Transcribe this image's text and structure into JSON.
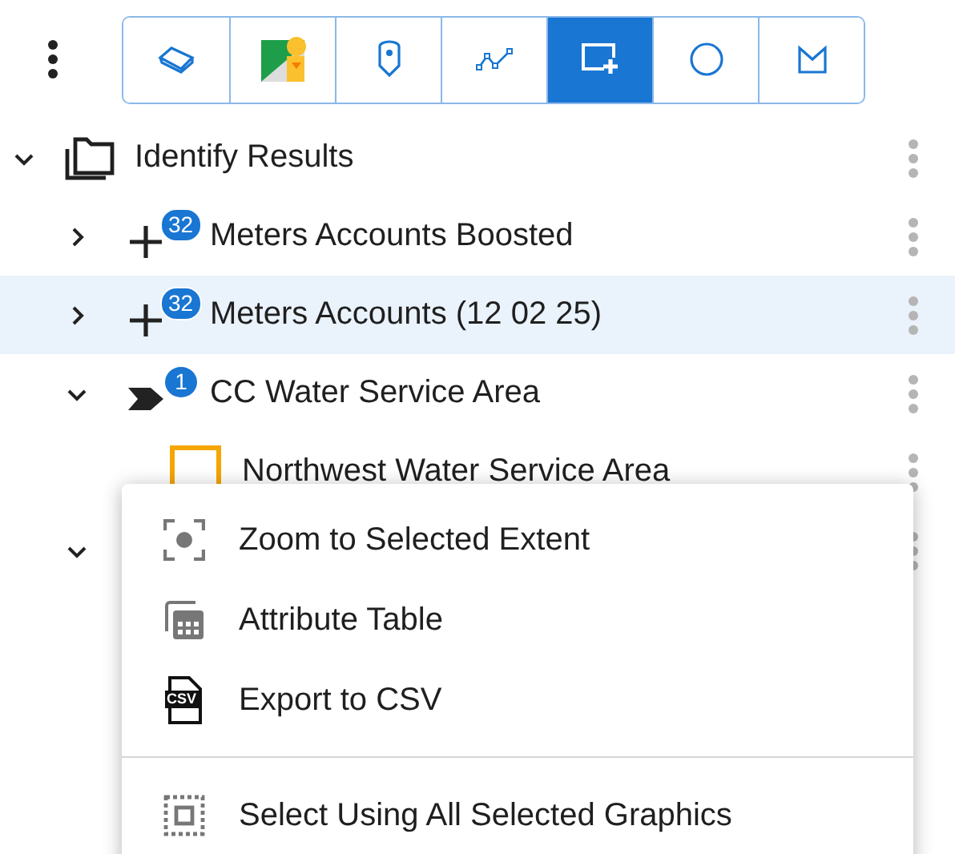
{
  "toolbar": {
    "tools": [
      {
        "kind": "eraser",
        "selected": false
      },
      {
        "kind": "streetview",
        "selected": false
      },
      {
        "kind": "pin",
        "selected": false
      },
      {
        "kind": "polyline",
        "selected": false
      },
      {
        "kind": "rectangle-add",
        "selected": true
      },
      {
        "kind": "circle",
        "selected": false
      },
      {
        "kind": "polygon",
        "selected": false
      }
    ]
  },
  "tree": [
    {
      "label": "Identify Results",
      "kind": "folder",
      "expanded": true,
      "selected": false,
      "children": [
        {
          "label": "Meters Accounts Boosted",
          "kind": "plus",
          "count": "32",
          "expanded": false,
          "selected": false
        },
        {
          "label": "Meters Accounts (12 02 25)",
          "kind": "plus",
          "count": "32",
          "expanded": false,
          "selected": true
        },
        {
          "label": "CC Water Service Area",
          "kind": "arrow",
          "count": "1",
          "expanded": true,
          "selected": false,
          "children": [
            {
              "label": "Northwest Water Service Area",
              "kind": "square",
              "selected": false
            }
          ]
        },
        {
          "expanded": true
        }
      ]
    }
  ],
  "context_menu": {
    "groups": [
      [
        {
          "label": "Zoom to Selected Extent",
          "kind": "zoom-extent"
        },
        {
          "label": "Attribute Table",
          "kind": "table"
        },
        {
          "label": "Export to CSV",
          "kind": "file",
          "icon_text": "CSV"
        }
      ],
      [
        {
          "label": "Select Using All Selected Graphics",
          "kind": "select"
        }
      ]
    ]
  }
}
